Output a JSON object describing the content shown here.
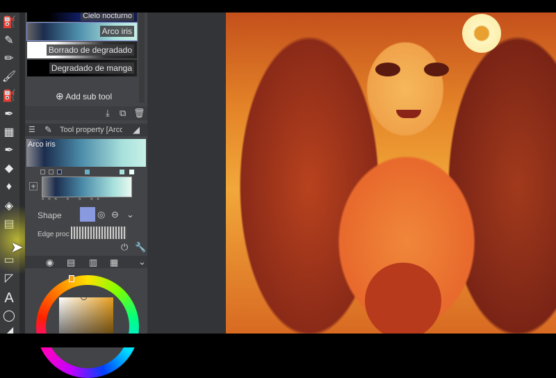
{
  "subtools": {
    "items": [
      {
        "label": "Cielo nocturno"
      },
      {
        "label": "Arco iris"
      },
      {
        "label": "Borrado de degradado"
      },
      {
        "label": "Degradado de manga"
      }
    ],
    "add_label": "Add sub tool"
  },
  "tool_property": {
    "title": "Tool property [Arco",
    "preview_label": "Arco iris",
    "shape_label": "Shape",
    "edge_label": "Edge proc"
  },
  "colors": {
    "accent": "#8a9ae0",
    "panel": "#434447",
    "gradient_start": "#1c2d4e",
    "gradient_end": "#c8f0e6"
  }
}
